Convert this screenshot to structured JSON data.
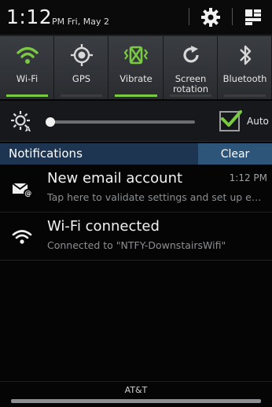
{
  "header": {
    "time": "1:12",
    "ampm": "PM Fri, May 2",
    "settings_icon": "gear-icon",
    "notification_toggle_icon": "notification-panel-icon"
  },
  "quick_settings": [
    {
      "label": "Wi-Fi",
      "icon": "wifi-icon",
      "on": true
    },
    {
      "label": "GPS",
      "icon": "gps-icon",
      "on": false
    },
    {
      "label": "Vibrate",
      "icon": "vibrate-icon",
      "on": true
    },
    {
      "label": "Screen rotation",
      "icon": "rotation-icon",
      "on": false
    },
    {
      "label": "Bluetooth",
      "icon": "bluetooth-icon",
      "on": false
    }
  ],
  "brightness": {
    "level": 0.0,
    "auto_label": "Auto",
    "auto_checked": true
  },
  "notifications_bar": {
    "title": "Notifications",
    "clear_label": "Clear"
  },
  "notifications": [
    {
      "title": "New email account",
      "time": "1:12 PM",
      "subtitle": "Tap here to validate settings and set up em...",
      "icon": "email-icon"
    },
    {
      "title": "Wi-Fi connected",
      "time": "",
      "subtitle": "Connected to \"NTFY-DownstairsWifi\"",
      "icon": "wifi-icon"
    }
  ],
  "carrier": "AT&T",
  "colors": {
    "accent_green": "#7ac943",
    "notif_bar": "#1d3550",
    "clear_button": "#2c5579"
  }
}
